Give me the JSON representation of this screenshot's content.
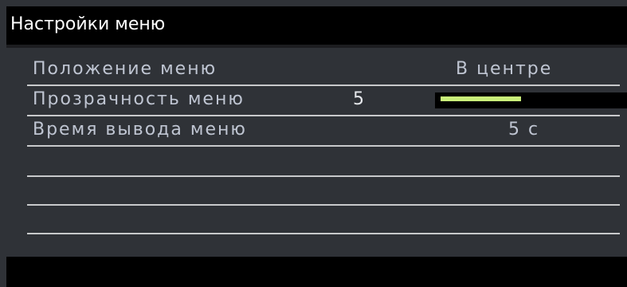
{
  "header": {
    "title": "Настройки меню"
  },
  "menu": {
    "position": {
      "label": "Положение меню",
      "value": "В центре"
    },
    "transparency": {
      "label": "Прозрачность меню",
      "value": "5",
      "level_fraction": 0.44
    },
    "display_time": {
      "label": "Время вывода меню",
      "value": "5 с"
    }
  },
  "colors": {
    "bar_fill": "#c9f07a",
    "text": "#bfc5d2",
    "background": "#2f3237"
  }
}
